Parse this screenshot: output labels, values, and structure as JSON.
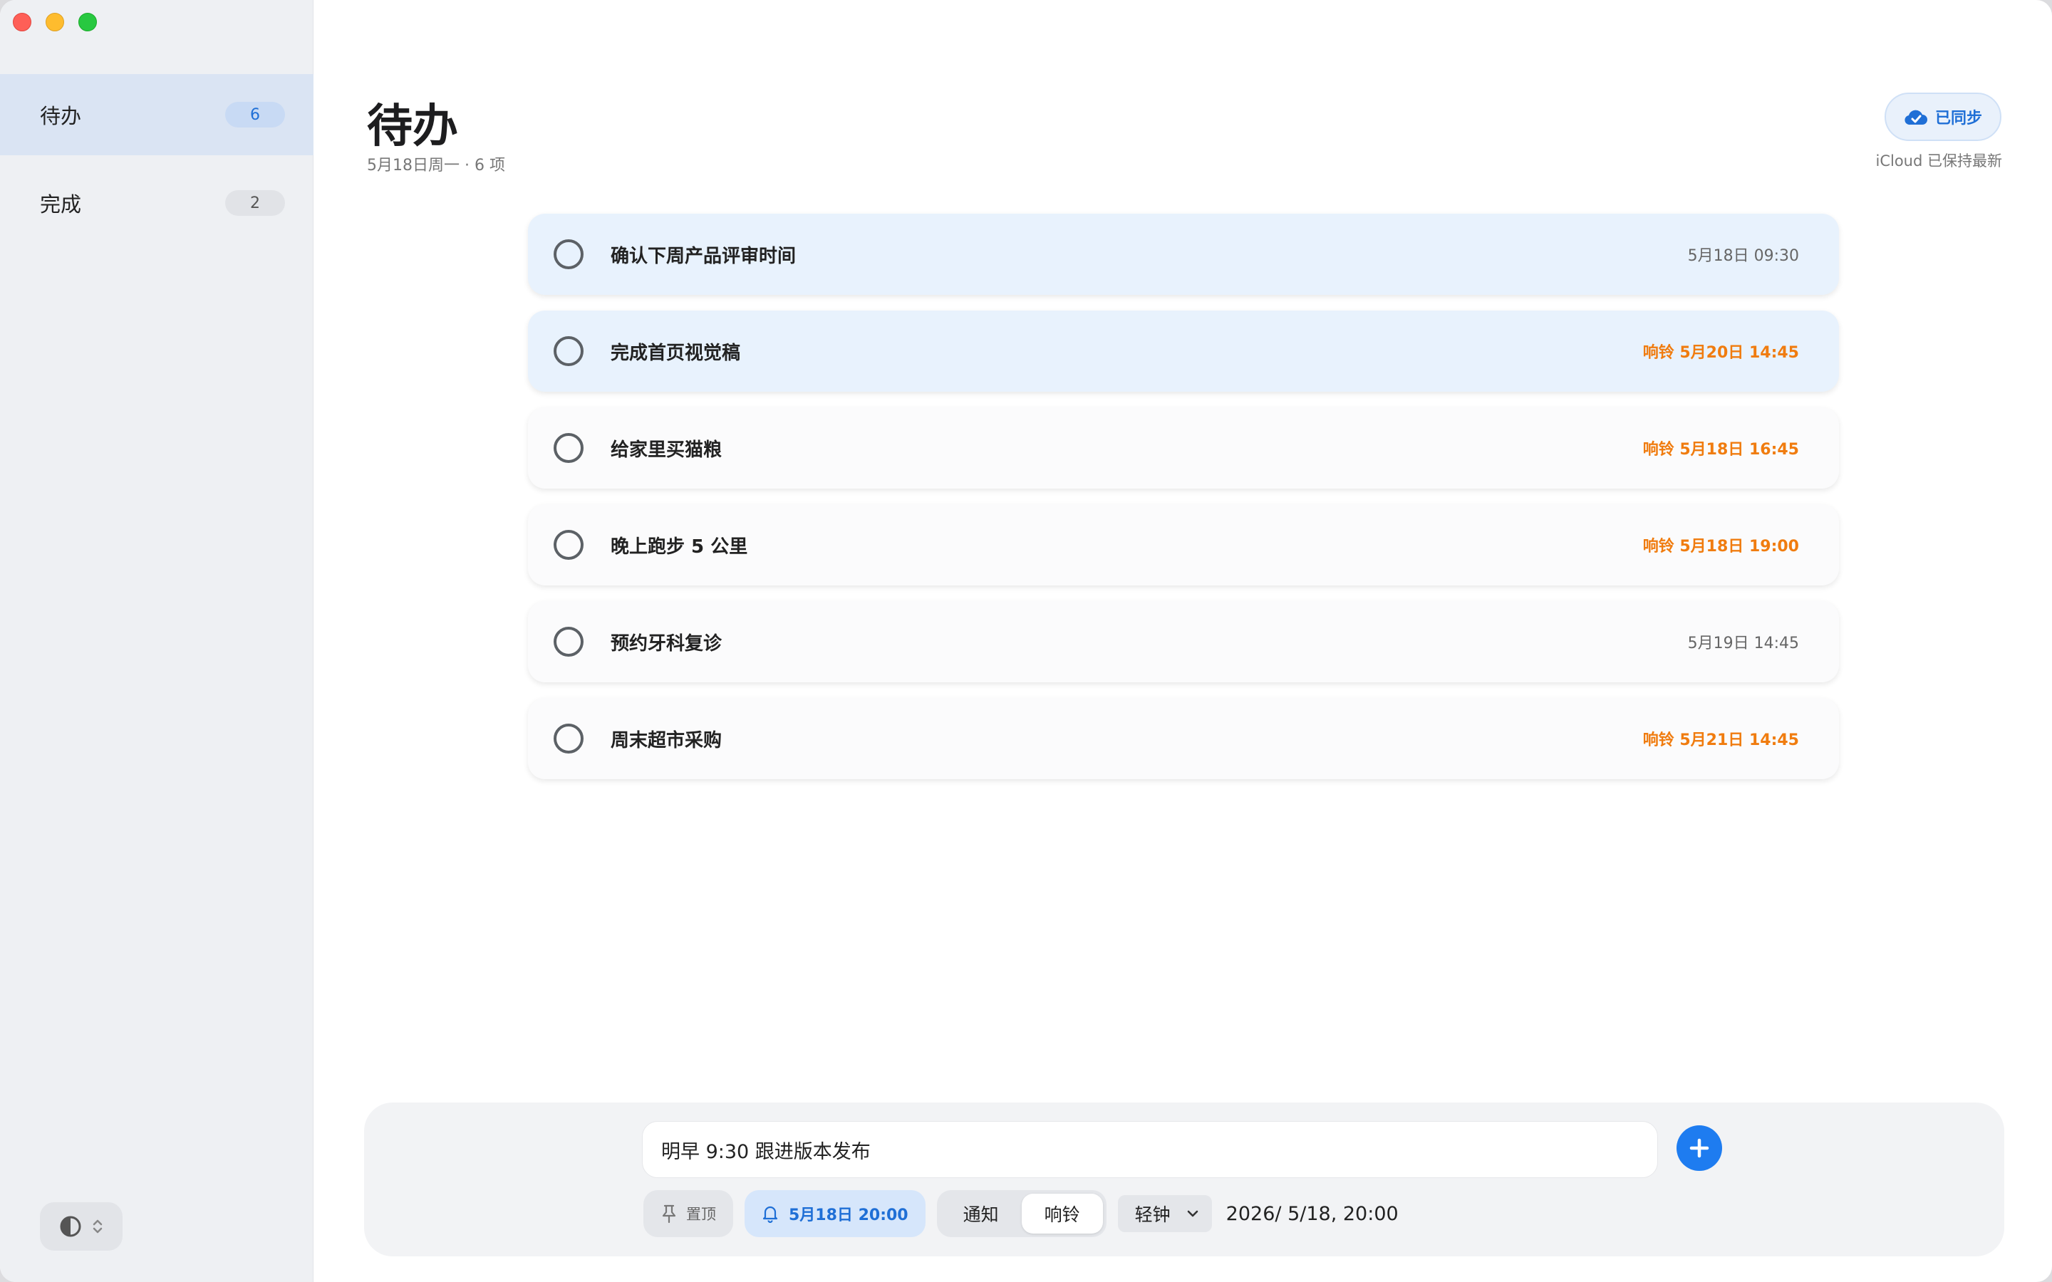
{
  "sidebar": {
    "items": [
      {
        "label": "待办",
        "count": "6"
      },
      {
        "label": "完成",
        "count": "2"
      }
    ]
  },
  "header": {
    "title": "待办",
    "subtitle": "5月18日周一 · 6 项",
    "sync_label": "已同步",
    "sync_note": "iCloud 已保持最新"
  },
  "tasks": [
    {
      "title": "确认下周产品评审时间",
      "time": "5月18日 09:30",
      "alarm": false,
      "highlight": true
    },
    {
      "title": "完成首页视觉稿",
      "time": "响铃 5月20日 14:45",
      "alarm": true,
      "highlight": true
    },
    {
      "title": "给家里买猫粮",
      "time": "响铃 5月18日 16:45",
      "alarm": true,
      "highlight": false
    },
    {
      "title": "晚上跑步 5 公里",
      "time": "响铃 5月18日 19:00",
      "alarm": true,
      "highlight": false
    },
    {
      "title": "预约牙科复诊",
      "time": "5月19日 14:45",
      "alarm": false,
      "highlight": false
    },
    {
      "title": "周末超市采购",
      "time": "响铃 5月21日 14:45",
      "alarm": true,
      "highlight": false
    }
  ],
  "composer": {
    "input_value": "明早 9:30 跟进版本发布",
    "pin_label": "置顶",
    "remind_label": "5月18日 20:00",
    "seg_notify": "通知",
    "seg_ring": "响铃",
    "sound_selected": "轻钟",
    "date_value": "2026/  5/18, 20:00"
  },
  "colors": {
    "accent": "#1e7cf0",
    "alarm": "#f07c0f",
    "sidebar_active": "#dae4f3"
  }
}
